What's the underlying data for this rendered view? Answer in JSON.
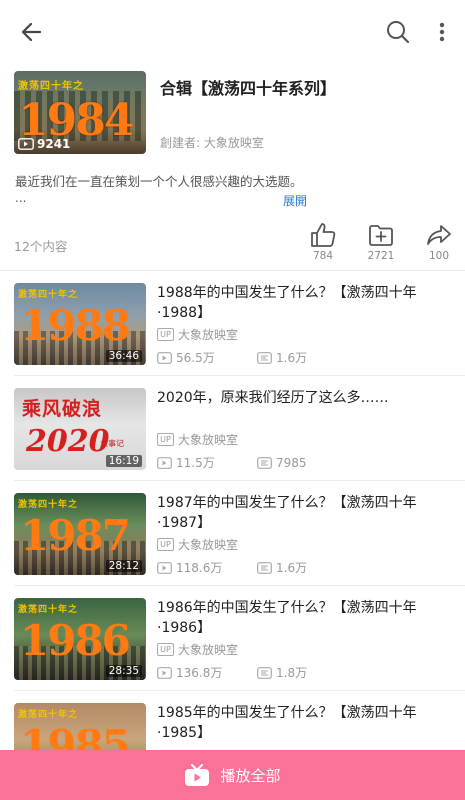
{
  "header": {
    "back_icon": "arrow-left-icon",
    "search_icon": "search-icon",
    "more_icon": "more-vertical-icon"
  },
  "playlist": {
    "cover_caption": "激荡四十年之",
    "cover_year": "1984",
    "cover_play_count": "9241",
    "title": "合辑【激荡四十年系列】",
    "creator": "創建者: 大象放映室",
    "description": "最近我们在一直在策划一个个人很感兴趣的大选题。",
    "ellipsis": "...",
    "expand_label": "展開",
    "item_count": "12个内容",
    "stats": {
      "likes": "784",
      "favorites": "2721",
      "shares": "100"
    }
  },
  "videos": [
    {
      "title": "1988年的中国发生了什么？【激荡四十年·1988】",
      "uploader": "大象放映室",
      "views": "56.5万",
      "danmaku": "1.6万",
      "duration": "36:46",
      "thumb_caption": "激荡四十年之",
      "thumb_year": "1988"
    },
    {
      "title": "2020年，原来我们经历了这么多……",
      "uploader": "大象放映室",
      "views": "11.5万",
      "danmaku": "7985",
      "duration": "16:19",
      "thumb_caption": "乘风破浪",
      "thumb_year": "2020",
      "thumb_tag": "大事记"
    },
    {
      "title": "1987年的中国发生了什么？【激荡四十年·1987】",
      "uploader": "大象放映室",
      "views": "118.6万",
      "danmaku": "1.6万",
      "duration": "28:12",
      "thumb_caption": "激荡四十年之",
      "thumb_year": "1987"
    },
    {
      "title": "1986年的中国发生了什么？【激荡四十年·1986】",
      "uploader": "大象放映室",
      "views": "136.8万",
      "danmaku": "1.8万",
      "duration": "28:35",
      "thumb_caption": "激荡四十年之",
      "thumb_year": "1986"
    },
    {
      "title": "1985年的中国发生了什么？【激荡四十年·1985】",
      "thumb_caption": "激荡四十年之",
      "thumb_year": "1985"
    }
  ],
  "labels": {
    "up_badge": "UP"
  },
  "footer": {
    "play_all_label": "播放全部",
    "play_icon": "tv-play-icon"
  },
  "colors": {
    "accent_pink": "#fb7299",
    "link_blue": "#2f77c9",
    "thumb_year_orange": "#ff7a12"
  }
}
